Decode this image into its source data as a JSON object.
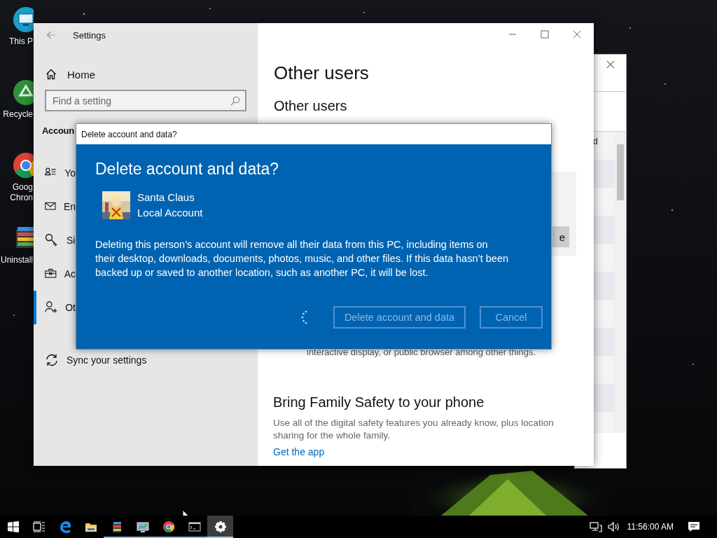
{
  "desktop_icons": [
    {
      "kind": "computer",
      "lines": [
        "This P"
      ]
    },
    {
      "kind": "recycle",
      "lines": [
        "Recycle"
      ]
    },
    {
      "kind": "chrome",
      "lines": [
        "Goog",
        "Chron"
      ]
    },
    {
      "kind": "tools",
      "lines": [
        "Uninstall"
      ]
    }
  ],
  "background_window": {
    "fragment": "d"
  },
  "settings_window": {
    "title": "Settings",
    "home": "Home",
    "search": {
      "placeholder": "Find a setting"
    },
    "section": "Accoun",
    "nav": [
      {
        "kind": "person-list",
        "label": "Yo",
        "selected": false
      },
      {
        "kind": "mail",
        "label": "En",
        "selected": false
      },
      {
        "kind": "key",
        "label": "Si",
        "selected": false
      },
      {
        "kind": "briefcase",
        "label": "Ac",
        "selected": false
      },
      {
        "kind": "person-add",
        "label": "Ot",
        "selected": true
      },
      {
        "kind": "sync",
        "label": "Sync your settings",
        "selected": false
      }
    ],
    "page_title": "Other users",
    "subtitle": "Other users",
    "button_fragment": "e",
    "text_fragment": "interactive display, or public browser among other things.",
    "family": {
      "heading": "Bring Family Safety to your phone",
      "text": "Use all of the digital safety features you already know, plus location sharing for the whole family.",
      "link": "Get the app"
    }
  },
  "dialog": {
    "title": "Delete account and data?",
    "heading": "Delete account and data?",
    "user": {
      "name": "Santa Claus",
      "type": "Local Account"
    },
    "message": "Deleting this person’s account will remove all their data from this PC, including items on their desktop, downloads, documents, photos, music, and other files. If this data hasn’t been backed up or saved to another location, such as another PC, it will be lost.",
    "busy": true,
    "buttons": [
      {
        "label": "Delete account and data",
        "disabled": true
      },
      {
        "label": "Cancel",
        "disabled": true
      }
    ]
  },
  "taskbar": {
    "apps": [
      {
        "kind": "edge",
        "running": false,
        "selected": false
      },
      {
        "kind": "folder",
        "running": false,
        "selected": false
      },
      {
        "kind": "books",
        "running": true,
        "selected": false
      },
      {
        "kind": "monitor",
        "running": true,
        "selected": false
      },
      {
        "kind": "chrome",
        "running": true,
        "selected": false
      },
      {
        "kind": "console",
        "running": true,
        "selected": false
      },
      {
        "kind": "gear",
        "running": true,
        "selected": true
      }
    ],
    "clock": "11:56:00 AM"
  }
}
